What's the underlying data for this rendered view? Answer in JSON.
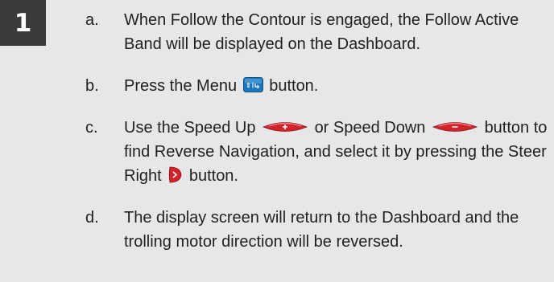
{
  "step_number": "1",
  "items": [
    {
      "letter": "a.",
      "text": "When Follow the Contour is engaged, the Follow Active Band will be displayed on the Dashboard."
    },
    {
      "letter": "b.",
      "pre": "Press the Menu",
      "post": "button."
    },
    {
      "letter": "c.",
      "pre": "Use the Speed Up",
      "mid": "or Speed Down",
      "post_line1": "button to find Reverse Navigation, and select it by pressing the Steer Right",
      "post": "button."
    },
    {
      "letter": "d.",
      "text": "The display screen will return to the Dashboard and the trolling motor direction will be reversed."
    }
  ],
  "icons": {
    "menu": "menu-button-icon",
    "speed_up": "speed-up-button-icon",
    "speed_down": "speed-down-button-icon",
    "steer_right": "steer-right-button-icon"
  },
  "colors": {
    "background": "#e6e7e8",
    "badge": "#3b3b3d",
    "menu_blue": "#1a75bc",
    "button_red": "#d2232a"
  }
}
